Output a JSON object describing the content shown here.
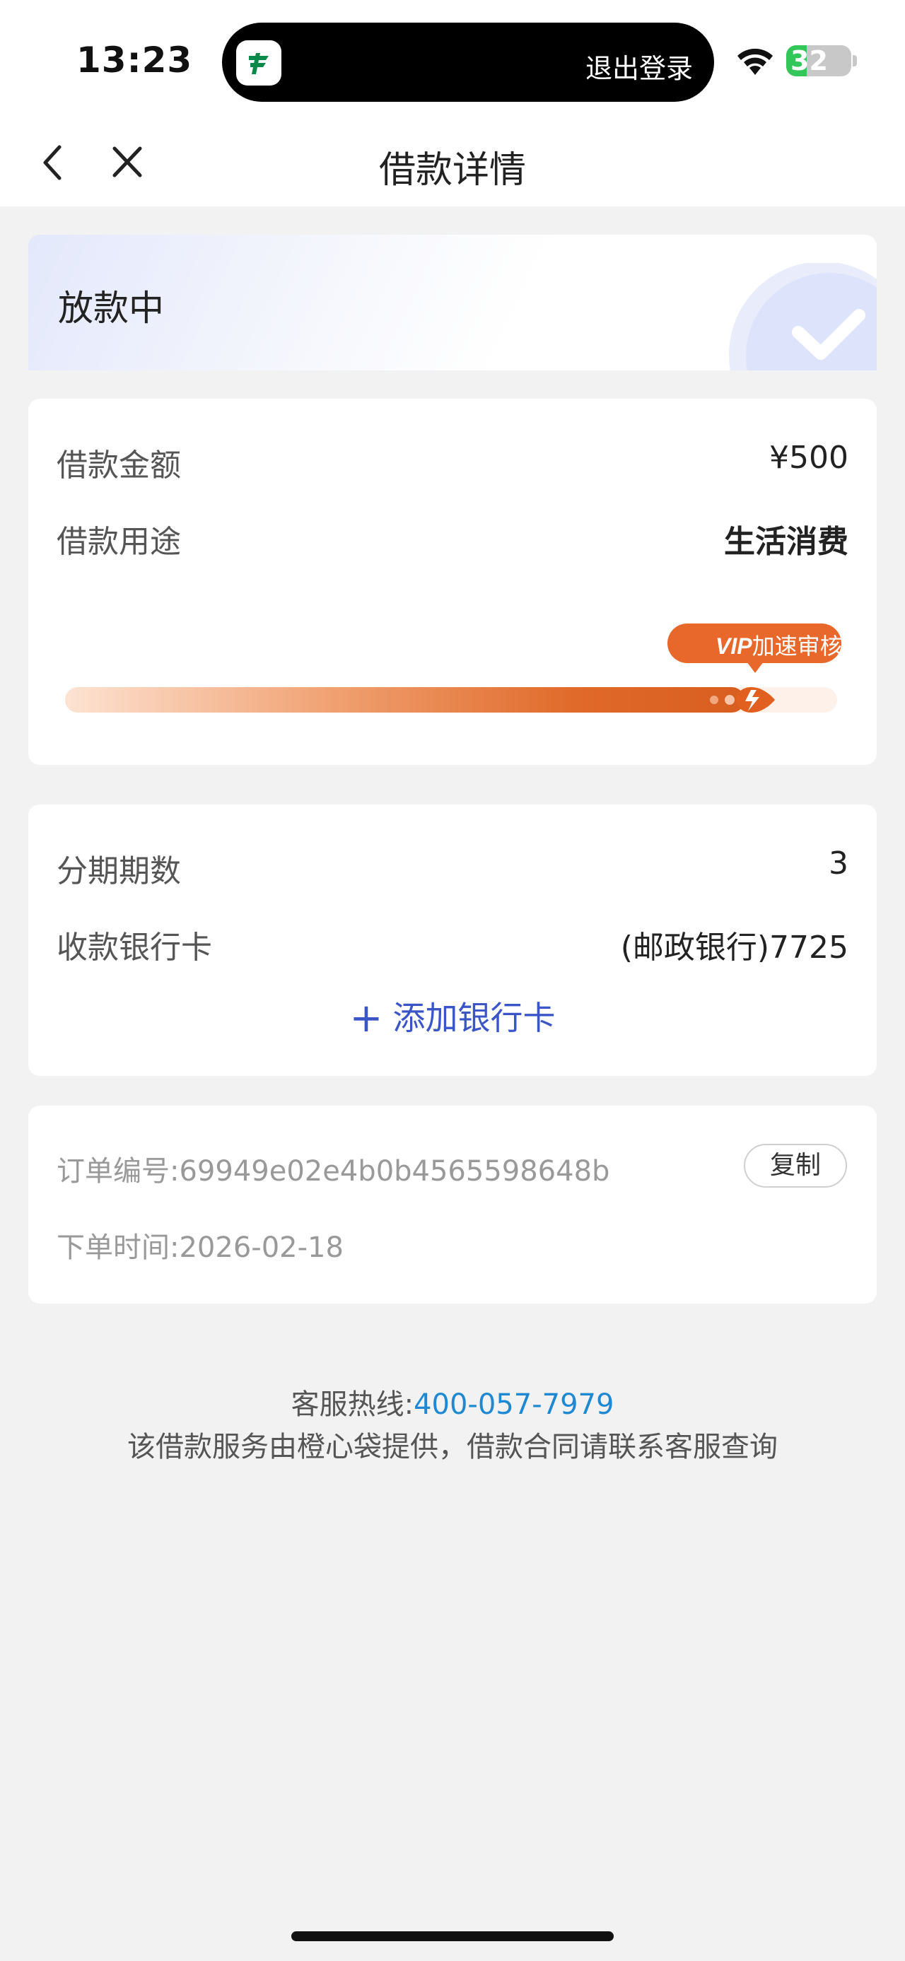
{
  "status_bar": {
    "time": "13:23",
    "island_action": "退出登录",
    "battery": "32"
  },
  "nav": {
    "title": "借款详情"
  },
  "status_card": {
    "title": "放款中"
  },
  "loan": {
    "amount_label": "借款金额",
    "amount_value": "¥500",
    "purpose_label": "借款用途",
    "purpose_value": "生活消费",
    "progress_fraction": 0.88,
    "vip_prefix": "VIP",
    "vip_text": "加速审核中"
  },
  "installment": {
    "periods_label": "分期期数",
    "periods_value": "3",
    "card_label": "收款银行卡",
    "card_value": "(邮政银行)7725",
    "add_card_label": "添加银行卡"
  },
  "order": {
    "id_label": "订单编号:",
    "id_value": "69949e02e4b0b4565598648b",
    "copy_label": "复制",
    "time_label": "下单时间:",
    "time_value": "2026-02-18"
  },
  "footer": {
    "hotline_label": "客服热线:",
    "hotline_number": "400-057-7979",
    "note": "该借款服务由橙心袋提供，借款合同请联系客服查询"
  },
  "colors": {
    "accent_blue": "#3a55c8",
    "link_blue": "#1e88d2",
    "progress_orange": "#e06a2a"
  },
  "icons": [
    "back-arrow-icon",
    "close-icon",
    "wifi-icon",
    "battery-icon",
    "check-icon",
    "rocket-icon",
    "plus-icon",
    "postal-app-icon"
  ]
}
